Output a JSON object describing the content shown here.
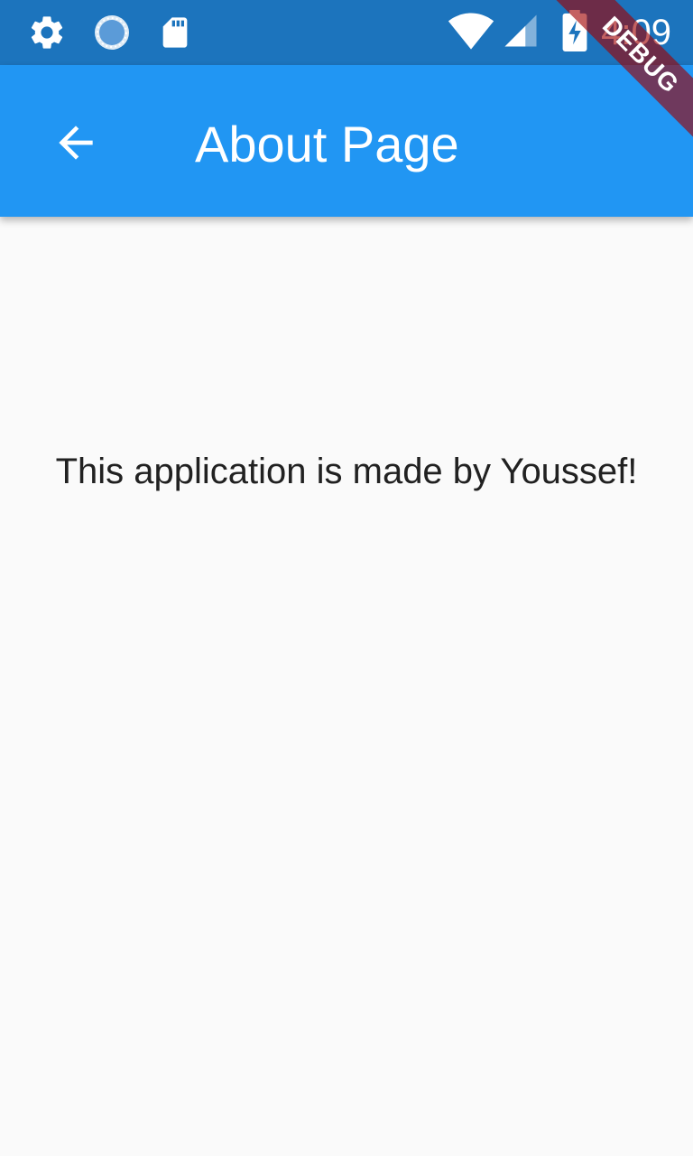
{
  "status_bar": {
    "time": "4:09",
    "left_icons": [
      "settings-icon",
      "sync-icon",
      "sd-card-icon"
    ],
    "right_icons": [
      "wifi-icon",
      "cell-signal-icon",
      "battery-charging-icon"
    ],
    "background_color": "#1c74bd"
  },
  "app_bar": {
    "title": "About Page",
    "back_icon": "arrow-back-icon",
    "background_color": "#2196f3"
  },
  "body": {
    "message": "This application is made by Youssef!"
  },
  "debug_banner": {
    "label": "DEBUG"
  }
}
